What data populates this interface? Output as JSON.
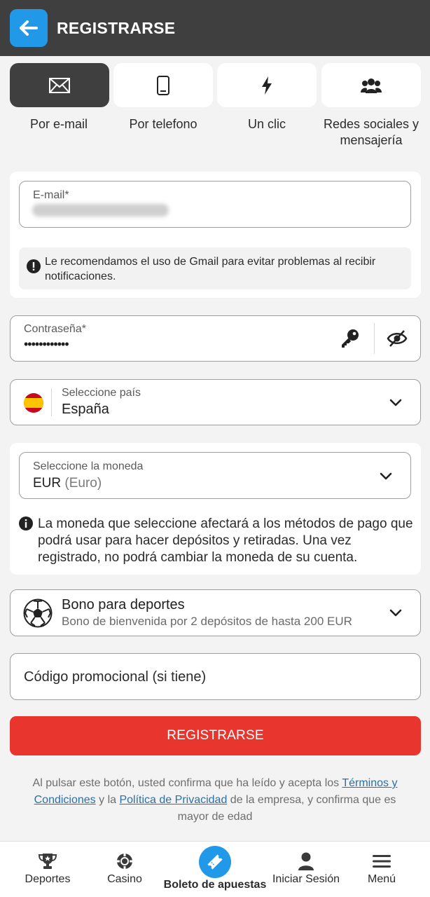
{
  "header": {
    "title": "REGISTRARSE"
  },
  "tabs": [
    {
      "label": "Por e-mail",
      "icon": "envelope-icon",
      "active": true
    },
    {
      "label": "Por telefono",
      "icon": "phone-icon",
      "active": false
    },
    {
      "label": "Un clic",
      "icon": "lightning-icon",
      "active": false
    },
    {
      "label": "Redes sociales y mensajería",
      "icon": "users-icon",
      "active": false
    }
  ],
  "email": {
    "label": "E-mail*",
    "hint": "Le recomendamos el uso de Gmail para evitar problemas al recibir notificaciones."
  },
  "password": {
    "label": "Contraseña*",
    "value": "••••••••••••"
  },
  "country": {
    "label": "Seleccione país",
    "value": "España"
  },
  "currency": {
    "label": "Seleccione la moneda",
    "code": "EUR",
    "name": "(Euro)",
    "note": "La moneda que seleccione afectará a los métodos de pago que podrá usar para hacer depósitos y retiradas. Una vez registrado, no podrá cambiar la moneda de su cuenta."
  },
  "bonus": {
    "title": "Bono para deportes",
    "subtitle": "Bono de bienvenida por 2 depósitos de hasta 200 EUR"
  },
  "promo": {
    "placeholder": "Código promocional (si tiene)"
  },
  "submit": {
    "label": "REGISTRARSE"
  },
  "legal": {
    "part1": "Al pulsar este botón, usted confirma que ha leído y acepta los ",
    "terms": "Términos y Condiciones",
    "part2": " y la ",
    "privacy": "Política de Privacidad",
    "part3": " de la empresa, y confirma que es mayor de edad"
  },
  "nav": [
    {
      "label": "Deportes",
      "icon": "trophy-icon"
    },
    {
      "label": "Casino",
      "icon": "casino-chip-icon"
    },
    {
      "label": "Boleto de apuestas",
      "icon": "ticket-icon"
    },
    {
      "label": "Iniciar Sesión",
      "icon": "user-icon"
    },
    {
      "label": "Menú",
      "icon": "hamburger-icon"
    }
  ],
  "colors": {
    "header": "#3f3f3f",
    "accent": "#2199e8",
    "cta": "#e8352e",
    "link": "#2b6fa8"
  }
}
